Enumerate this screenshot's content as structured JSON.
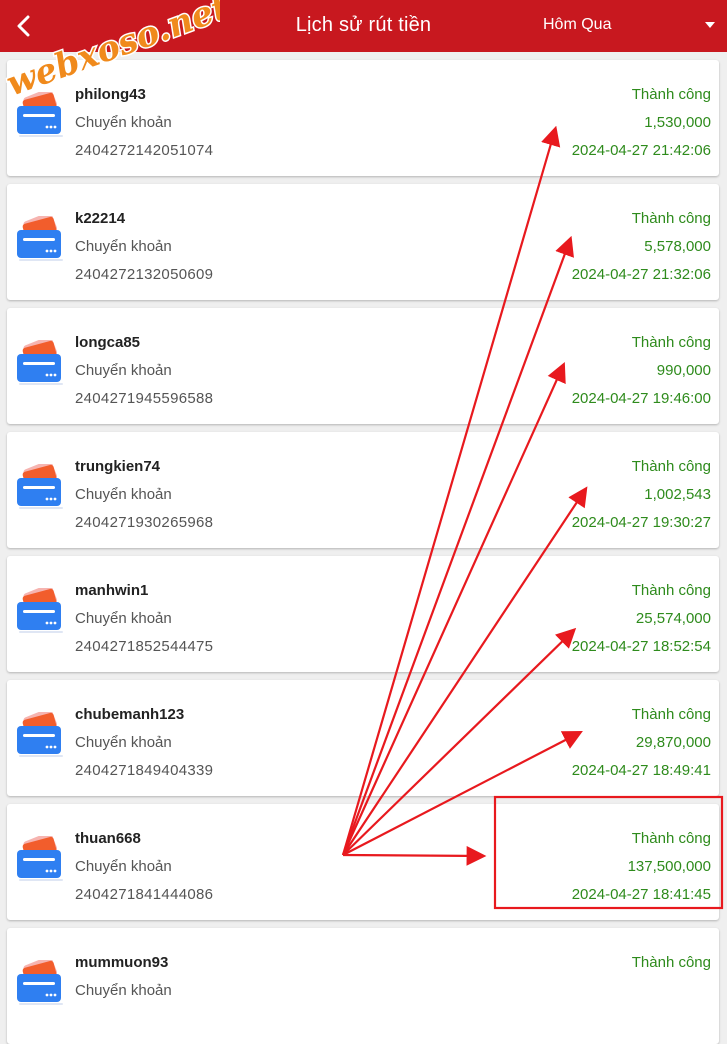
{
  "header": {
    "back_icon": "chevron-left-icon",
    "title": "Lịch sử rút tiền",
    "filter_value": "Hôm Qua",
    "caret_icon": "caret-down-icon"
  },
  "watermark": {
    "text": "webxoso.net"
  },
  "colors": {
    "header_bg": "#c8181f",
    "success_text": "#2e8b1c",
    "annotation_red": "#e8191e",
    "watermark_fill": "#f08a1c"
  },
  "transactions": [
    {
      "username": "philong43",
      "method": "Chuyển khoản",
      "code": "2404272142051074",
      "status": "Thành công",
      "amount": "1,530,000",
      "time": "2024-04-27 21:42:06"
    },
    {
      "username": "k22214",
      "method": "Chuyển khoản",
      "code": "2404272132050609",
      "status": "Thành công",
      "amount": "5,578,000",
      "time": "2024-04-27 21:32:06"
    },
    {
      "username": "longca85",
      "method": "Chuyển khoản",
      "code": "2404271945596588",
      "status": "Thành công",
      "amount": "990,000",
      "time": "2024-04-27 19:46:00"
    },
    {
      "username": "trungkien74",
      "method": "Chuyển khoản",
      "code": "2404271930265968",
      "status": "Thành công",
      "amount": "1,002,543",
      "time": "2024-04-27 19:30:27"
    },
    {
      "username": "manhwin1",
      "method": "Chuyển khoản",
      "code": "2404271852544475",
      "status": "Thành công",
      "amount": "25,574,000",
      "time": "2024-04-27 18:52:54"
    },
    {
      "username": "chubemanh123",
      "method": "Chuyển khoản",
      "code": "2404271849404339",
      "status": "Thành công",
      "amount": "29,870,000",
      "time": "2024-04-27 18:49:41"
    },
    {
      "username": "thuan668",
      "method": "Chuyển khoản",
      "code": "2404271841444086",
      "status": "Thành công",
      "amount": "137,500,000",
      "time": "2024-04-27 18:41:45"
    },
    {
      "username": "mummuon93",
      "method": "Chuyển khoản",
      "code": "",
      "status": "Thành công",
      "amount": "",
      "time": ""
    }
  ]
}
